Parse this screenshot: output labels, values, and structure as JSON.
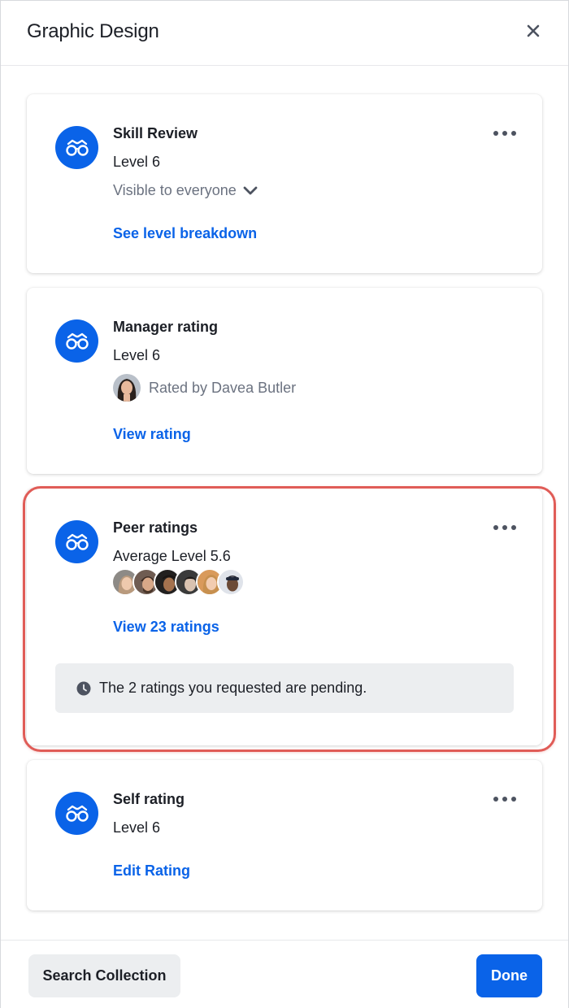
{
  "header": {
    "title": "Graphic Design",
    "close_icon": "close-icon"
  },
  "cards": {
    "skill_review": {
      "label": "Skill Review",
      "level": "Level 6",
      "visibility": "Visible to everyone",
      "link": "See level breakdown",
      "icon": "glasses-icon"
    },
    "manager_rating": {
      "label": "Manager rating",
      "level": "Level 6",
      "rated_by": "Rated by Davea Butler",
      "link": "View rating",
      "icon": "glasses-icon"
    },
    "peer_ratings": {
      "label": "Peer ratings",
      "level": "Average Level 5.6",
      "link": "View 23 ratings",
      "pending_notice": "The 2 ratings you requested are pending.",
      "icon": "glasses-icon",
      "avatar_count": 6
    },
    "self_rating": {
      "label": "Self rating",
      "level": "Level 6",
      "link": "Edit Rating",
      "icon": "glasses-icon"
    }
  },
  "footer": {
    "secondary_button": "Search Collection",
    "primary_button": "Done"
  },
  "colors": {
    "accent": "#0a63e8",
    "highlight": "#e05c57",
    "muted_text": "#6b7280",
    "notice_bg": "#eceef0"
  }
}
